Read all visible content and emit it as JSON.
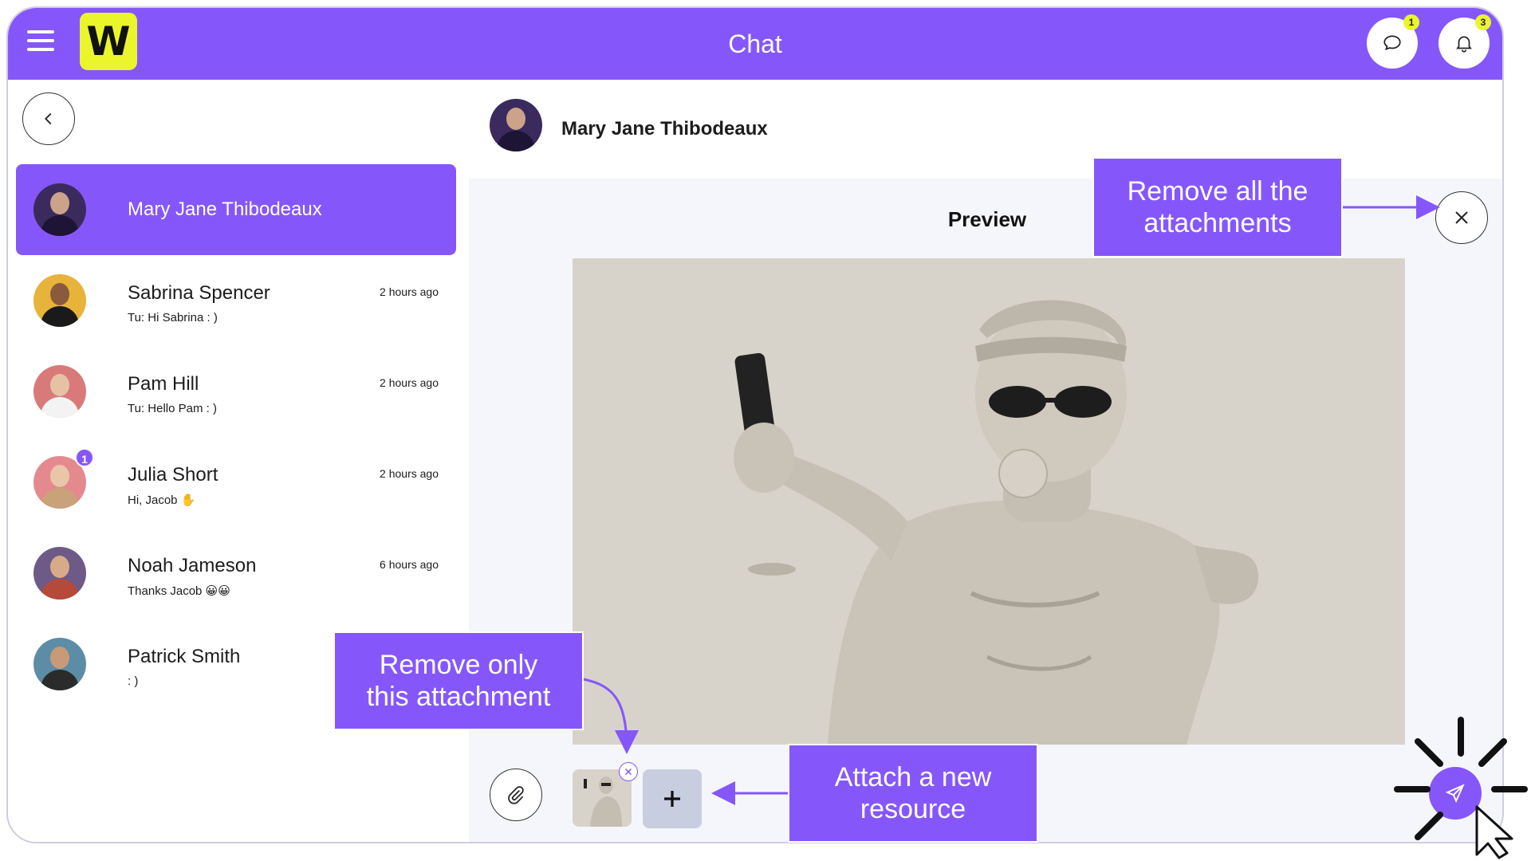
{
  "header": {
    "logo_text": "W",
    "title": "Chat",
    "messages_badge": "1",
    "notifications_badge": "3"
  },
  "contacts": [
    {
      "name": "Mary Jane Thibodeaux",
      "message": "",
      "time": "",
      "badge": ""
    },
    {
      "name": "Sabrina Spencer",
      "message": "Tu: Hi Sabrina : )",
      "time": "2 hours ago",
      "badge": ""
    },
    {
      "name": "Pam Hill",
      "message": "Tu: Hello Pam : )",
      "time": "2 hours ago",
      "badge": ""
    },
    {
      "name": "Julia Short",
      "message": "Hi, Jacob ✋",
      "time": "2 hours ago",
      "badge": "1"
    },
    {
      "name": "Noah Jameson",
      "message": "Thanks Jacob 😀😀",
      "time": "6 hours ago",
      "badge": ""
    },
    {
      "name": "Patrick Smith",
      "message": ": )",
      "time": "",
      "badge": ""
    }
  ],
  "chat": {
    "contact_name": "Mary Jane Thibodeaux",
    "preview_title": "Preview"
  },
  "annotations": {
    "remove_all_line1": "Remove all the",
    "remove_all_line2": "attachments",
    "remove_one_line1": "Remove only",
    "remove_one_line2": "this attachment",
    "attach_new_line1": "Attach a new",
    "attach_new_line2": "resource"
  },
  "colors": {
    "accent": "#8557fb",
    "logo": "#eaf52b",
    "preview_bg": "#f5f6fb"
  },
  "icons": {
    "menu": "hamburger-menu-icon",
    "messages": "chat-bubble-icon",
    "notifications": "bell-icon",
    "back": "chevron-left-icon",
    "close": "close-icon",
    "attach": "paperclip-icon",
    "add": "plus-icon",
    "send": "paper-plane-icon"
  }
}
